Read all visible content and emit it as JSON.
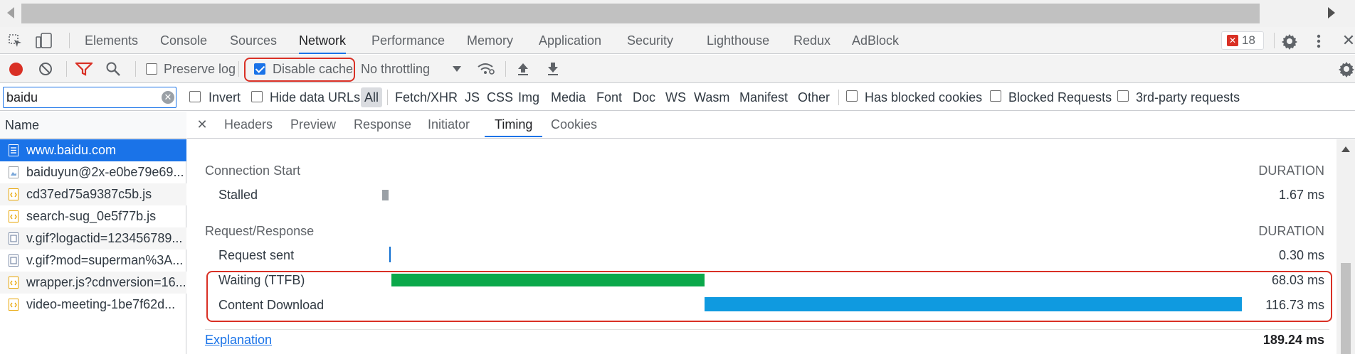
{
  "main_tabs": [
    "Elements",
    "Console",
    "Sources",
    "Network",
    "Performance",
    "Memory",
    "Application",
    "Security",
    "Lighthouse",
    "Redux",
    "AdBlock"
  ],
  "active_main_tab": "Network",
  "error_badge": "18",
  "toolbar": {
    "preserve_log": "Preserve log",
    "disable_cache": "Disable cache",
    "throttling": "No throttling"
  },
  "filter": {
    "value": "baidu",
    "invert": "Invert",
    "hide_data_urls": "Hide data URLs",
    "types": [
      "All",
      "Fetch/XHR",
      "JS",
      "CSS",
      "Img",
      "Media",
      "Font",
      "Doc",
      "WS",
      "Wasm",
      "Manifest",
      "Other"
    ],
    "has_blocked_cookies": "Has blocked cookies",
    "blocked_requests": "Blocked Requests",
    "third_party": "3rd-party requests"
  },
  "request_list": {
    "header": "Name",
    "items": [
      "www.baidu.com",
      "baiduyun@2x-e0be79e69...",
      "cd37ed75a9387c5b.js",
      "search-sug_0e5f77b.js",
      "v.gif?logactid=123456789...",
      "v.gif?mod=superman%3A...",
      "wrapper.js?cdnversion=16...",
      "video-meeting-1be7f62d..."
    ]
  },
  "detail_tabs": [
    "Headers",
    "Preview",
    "Response",
    "Initiator",
    "Timing",
    "Cookies"
  ],
  "active_detail_tab": "Timing",
  "timing": {
    "connection_start": "Connection Start",
    "duration_label": "DURATION",
    "stalled": {
      "label": "Stalled",
      "value": "1.67 ms"
    },
    "request_response": "Request/Response",
    "request_sent": {
      "label": "Request sent",
      "value": "0.30 ms"
    },
    "waiting": {
      "label": "Waiting (TTFB)",
      "value": "68.03 ms"
    },
    "content_download": {
      "label": "Content Download",
      "value": "116.73 ms"
    },
    "explanation": "Explanation",
    "total": "189.24 ms"
  },
  "colors": {
    "waiting_bar": "#0ba84a",
    "download_bar": "#0f9ae0",
    "stalled_bar": "#9aa0a6",
    "selection": "#1a73e8",
    "highlight_box": "#d93025"
  }
}
